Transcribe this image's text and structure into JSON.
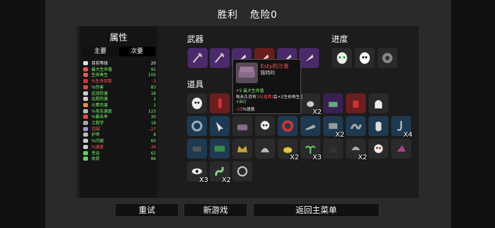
{
  "header": {
    "result": "胜利",
    "danger": "危险0"
  },
  "stats": {
    "title": "属性",
    "tab_primary": "主要",
    "tab_secondary": "次要",
    "rows": [
      {
        "label": "目前等级",
        "value": "20",
        "color": "#ffffff",
        "vcolor": "#ffffff",
        "icon": "#dddddd"
      },
      {
        "label": "最大生命值",
        "value": "91",
        "color": "#7dff6b",
        "vcolor": "#7dff6b",
        "icon": "#e55"
      },
      {
        "label": "生命再生",
        "value": "105",
        "color": "#7dff6b",
        "vcolor": "#7dff6b",
        "icon": "#e55"
      },
      {
        "label": "%生命窃取",
        "value": "-3",
        "color": "#ff5a5a",
        "vcolor": "#ff5a5a",
        "icon": "#c33"
      },
      {
        "label": "%伤害",
        "value": "83",
        "color": "#7dff6b",
        "vcolor": "#7dff6b",
        "icon": "#d44"
      },
      {
        "label": "近战伤害",
        "value": "18",
        "color": "#7dff6b",
        "vcolor": "#7dff6b",
        "icon": "#ccc"
      },
      {
        "label": "远程伤害",
        "value": "2",
        "color": "#7dff6b",
        "vcolor": "#7dff6b",
        "icon": "#ccc"
      },
      {
        "label": "元素伤害",
        "value": "1",
        "color": "#7dff6b",
        "vcolor": "#7dff6b",
        "icon": "#e84"
      },
      {
        "label": "%攻击速度",
        "value": "123",
        "color": "#7dff6b",
        "vcolor": "#7dff6b",
        "icon": "#bbb"
      },
      {
        "label": "%暴击率",
        "value": "30",
        "color": "#7dff6b",
        "vcolor": "#7dff6b",
        "icon": "#e44"
      },
      {
        "label": "工程学",
        "value": "18",
        "color": "#7dff6b",
        "vcolor": "#7dff6b",
        "icon": "#aaa"
      },
      {
        "label": "范围",
        "value": "-27",
        "color": "#ff5a5a",
        "vcolor": "#ff5a5a",
        "icon": "#99c"
      },
      {
        "label": "护甲",
        "value": "8",
        "color": "#7dff6b",
        "vcolor": "#7dff6b",
        "icon": "#bbb"
      },
      {
        "label": "%闪避",
        "value": "60",
        "color": "#7dff6b",
        "vcolor": "#7dff6b",
        "icon": "#ccc"
      },
      {
        "label": "%速度",
        "value": "-36",
        "color": "#ff5a5a",
        "vcolor": "#ff5a5a",
        "icon": "#ccc"
      },
      {
        "label": "幸运",
        "value": "62",
        "color": "#7dff6b",
        "vcolor": "#7dff6b",
        "icon": "#6c6"
      },
      {
        "label": "收获",
        "value": "86",
        "color": "#7dff6b",
        "vcolor": "#7dff6b",
        "icon": "#6c6"
      }
    ]
  },
  "sections": {
    "weapons": "武器",
    "items": "道具",
    "progress": "进度"
  },
  "tooltip": {
    "name": "Esty的沙发",
    "rarity": "独特的",
    "line1": "+5 最大生命值",
    "line2a": "每永久持有",
    "line2b": "10(道具)",
    "line2c": "会+2生命再生 [",
    "line3": "+80]",
    "line4a": "-15",
    "line4b": "%速度"
  },
  "item_badges": [
    "X2",
    "X2",
    "X4",
    "X2",
    "X3",
    "X2",
    "X3",
    "X2"
  ],
  "buttons": {
    "retry": "重试",
    "new_game": "新游戏",
    "main_menu": "返回主菜单"
  },
  "colors": {
    "positive": "#7dff6b",
    "negative": "#ff5a5a",
    "weapon_slot": "#4a2a6a",
    "tooltip_name": "#ff5a5a"
  }
}
